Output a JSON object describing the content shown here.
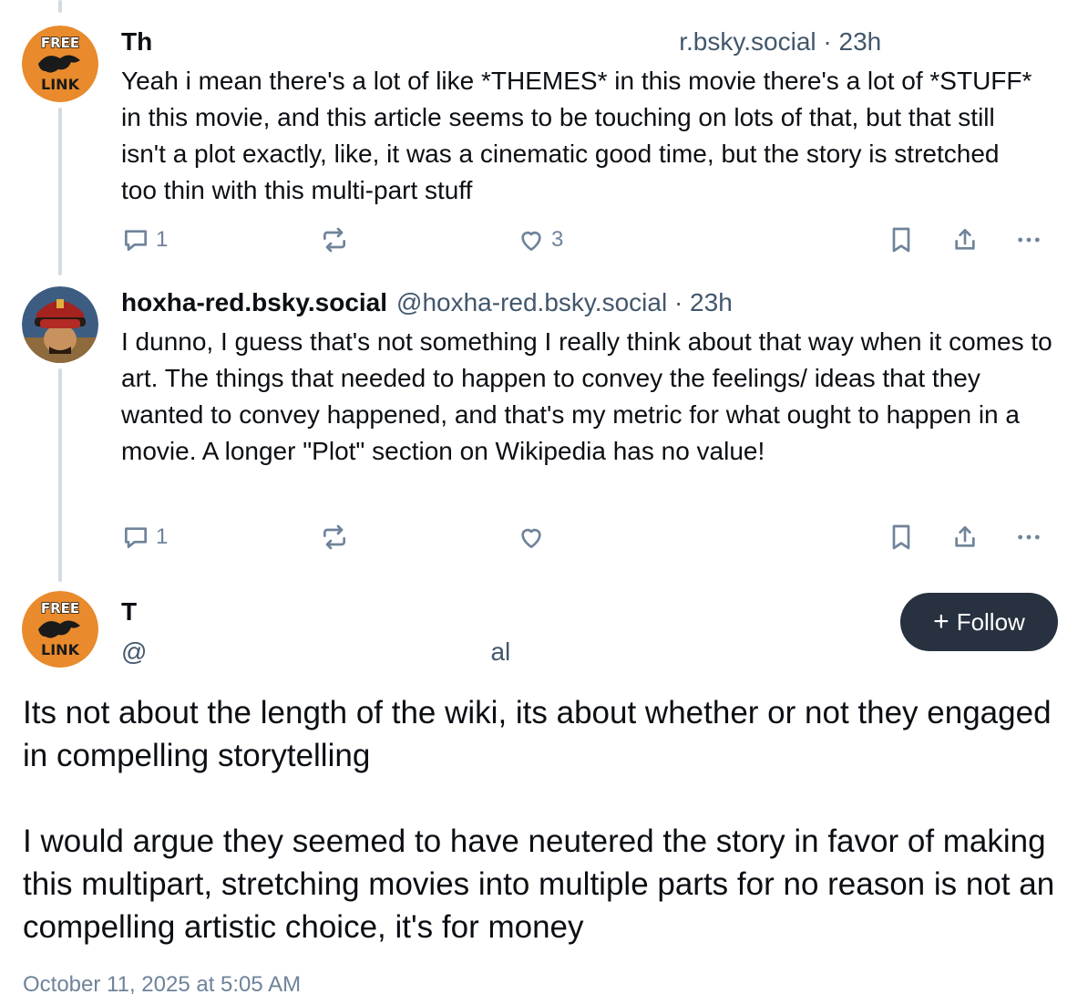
{
  "posts": [
    {
      "author_name": "Th",
      "author_handle_meta": "r.bsky.social · 23h",
      "text": "Yeah i mean there's a lot of like *THEMES* in this movie there's a lot of *STUFF* in this movie, and this article seems to be touching on lots of that, but that still isn't a plot exactly, like, it was a cinematic good time, but the story is stretched too thin with this multi-part stuff",
      "reply_count": "1",
      "repost_count": "",
      "like_count": "3",
      "avatar_text_top": "FREE",
      "avatar_text_bottom": "LINK"
    },
    {
      "author_name": "hoxha-red.bsky.social",
      "author_handle_meta": "@hoxha-red.bsky.social · 23h",
      "text": "I dunno, I guess that's not something I really think about that way when it comes to art. The things that needed to happen to convey the feelings/ ideas that they wanted to convey happened, and that's my metric for what ought to happen in a movie. A longer \"Plot\" section on Wikipedia has no value!",
      "reply_count": "1",
      "repost_count": "",
      "like_count": ""
    }
  ],
  "main_post": {
    "author_name": "T",
    "handle_start": "@",
    "handle_end": "al",
    "follow_label": "Follow",
    "avatar_text_top": "FREE",
    "avatar_text_bottom": "LINK",
    "text": "Its not about the length of the wiki, its about whether or not they engaged in compelling storytelling\n\nI would argue they seemed to have neutered the story in favor of making this multipart, stretching movies into multiple parts for no reason is not an compelling artistic choice, it's for money",
    "timestamp": "October 11, 2025 at 5:05 AM"
  },
  "colors": {
    "text": "#0b0f14",
    "muted": "#6f839a",
    "thread_line": "#d4dbe2",
    "follow_bg": "#27313f",
    "avatar_orange": "#e98a2c"
  },
  "icons": [
    "reply-icon",
    "repost-icon",
    "like-icon",
    "bookmark-icon",
    "share-icon",
    "more-icon"
  ]
}
